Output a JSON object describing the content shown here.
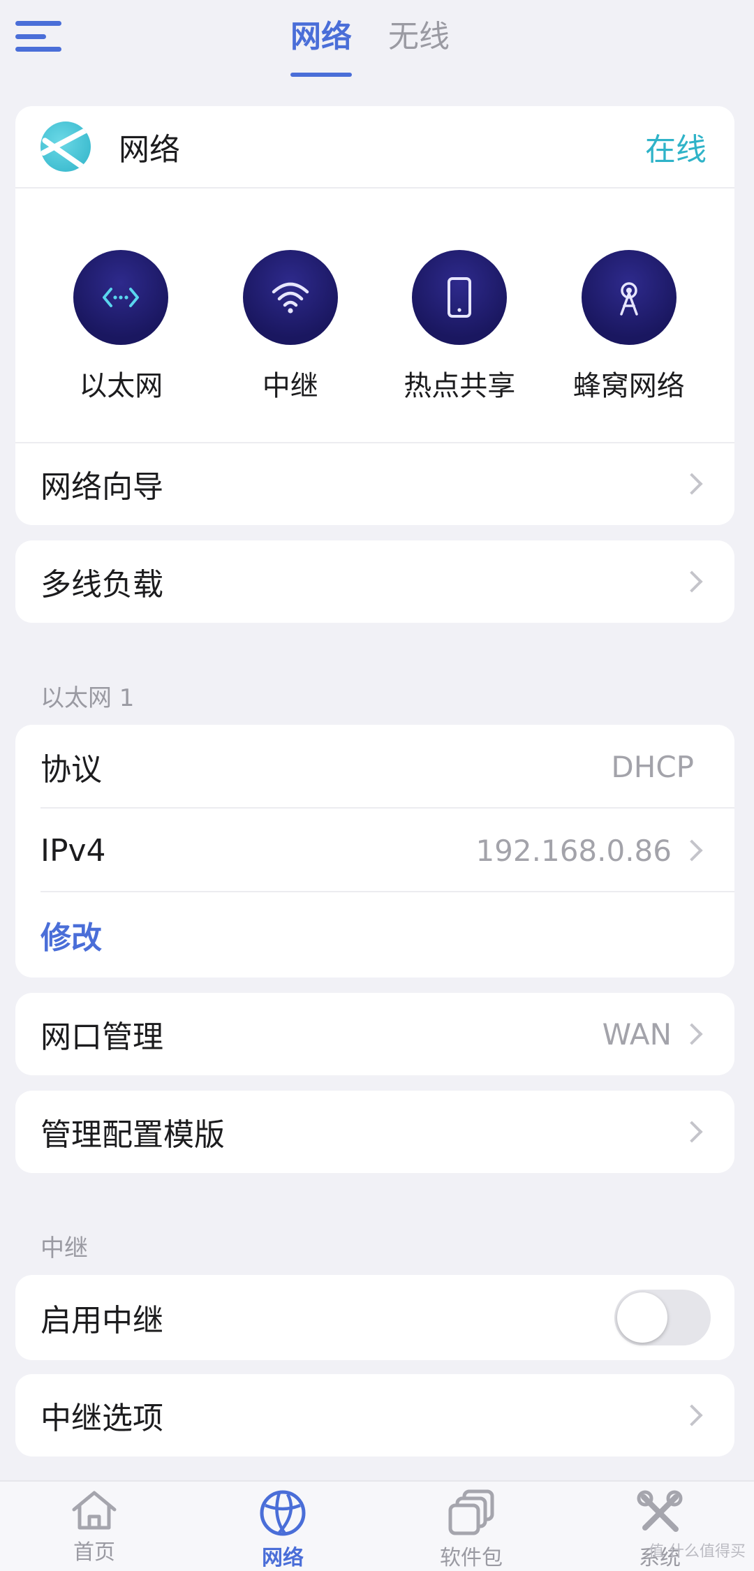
{
  "header": {
    "tabs": [
      {
        "label": "网络",
        "active": true
      },
      {
        "label": "无线",
        "active": false
      }
    ]
  },
  "network_card": {
    "title": "网络",
    "status": "在线",
    "modes": [
      {
        "label": "以太网",
        "icon": "ethernet-icon"
      },
      {
        "label": "中继",
        "icon": "wifi-icon"
      },
      {
        "label": "热点共享",
        "icon": "phone-hotspot-icon"
      },
      {
        "label": "蜂窝网络",
        "icon": "cellular-tower-icon"
      }
    ],
    "wizard_label": "网络向导"
  },
  "multi_line": {
    "label": "多线负载"
  },
  "ethernet1": {
    "section_label": "以太网 1",
    "protocol_label": "协议",
    "protocol_value": "DHCP",
    "ipv4_label": "IPv4",
    "ipv4_value": "192.168.0.86",
    "edit_label": "修改"
  },
  "port_management": {
    "label": "网口管理",
    "value": "WAN"
  },
  "config_template": {
    "label": "管理配置模版"
  },
  "relay": {
    "section_label": "中继",
    "enable_label": "启用中继",
    "enabled": false,
    "options_label": "中继选项"
  },
  "bottom_nav": {
    "items": [
      {
        "label": "首页",
        "icon": "home-icon",
        "active": false
      },
      {
        "label": "网络",
        "icon": "globe-icon",
        "active": true
      },
      {
        "label": "软件包",
        "icon": "packages-icon",
        "active": false
      },
      {
        "label": "系统",
        "icon": "tools-icon",
        "active": false
      }
    ],
    "watermark": "值 什么值得买"
  },
  "colors": {
    "accent": "#4a6ed8",
    "online": "#2fb3c8",
    "mode_circle": "#1a1760",
    "background": "#f1f1f6"
  }
}
